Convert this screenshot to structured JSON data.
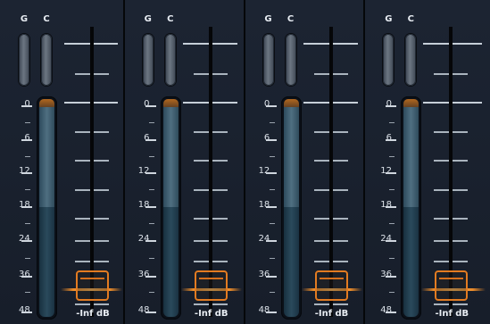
{
  "strips": [
    {
      "group_label": "G",
      "clip_label": "C",
      "level": "-Inf dB"
    },
    {
      "group_label": "G",
      "clip_label": "C",
      "level": "-Inf dB"
    },
    {
      "group_label": "G",
      "clip_label": "C",
      "level": "-Inf dB"
    },
    {
      "group_label": "G",
      "clip_label": "C",
      "level": "-Inf dB"
    }
  ],
  "scale": [
    "0",
    "6",
    "12",
    "18",
    "24",
    "36",
    "48"
  ],
  "colors": {
    "fader_accent": "#e27b21",
    "meter_fill": "#4f6f81",
    "panel_bg": "#1c2432"
  }
}
